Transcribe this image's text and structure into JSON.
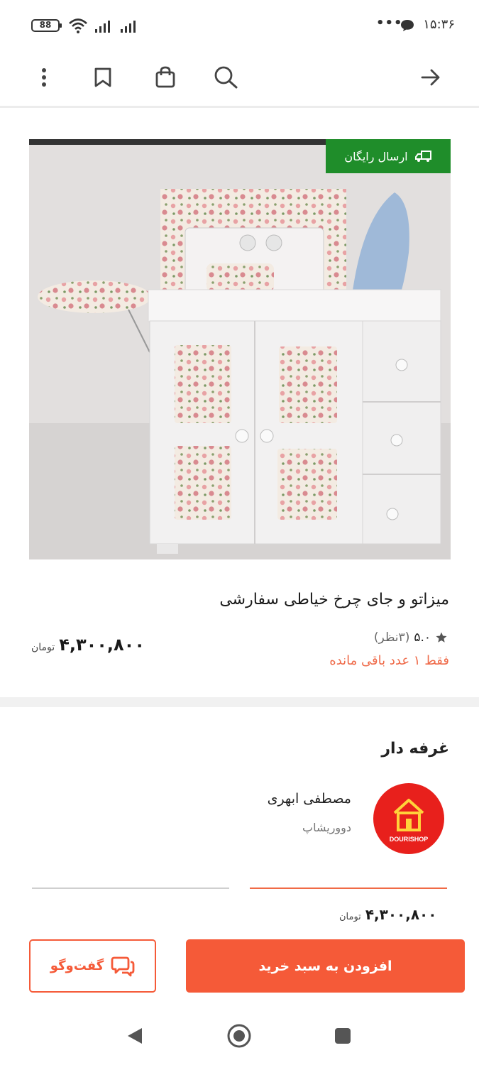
{
  "status_bar": {
    "battery": "88",
    "time": "۱۵:۳۶",
    "dots": "•••"
  },
  "product": {
    "free_shipping": "ارسال رایگان",
    "title": "میزاتو و جای چرخ خیاطی سفارشی",
    "rating": "۵.۰",
    "rating_count": "(۳نظر)",
    "stock": "فقط ۱ عدد باقی مانده",
    "price": "۴,۳۰۰,۸۰۰",
    "currency": "تومان"
  },
  "booth": {
    "title": "غرفه دار",
    "seller_name": "مصطفی ابهری",
    "shop_name": "دووریشاپ",
    "logo_text": "DOURISHOP"
  },
  "footer": {
    "price": "۴,۳۰۰,۸۰۰",
    "currency": "تومان",
    "add_to_cart": "افزودن به سبد خرید",
    "chat": "گفت‌وگو"
  },
  "colors": {
    "accent": "#f55a38",
    "free_shipping_bg": "#1f8d2a",
    "stock_text": "#ef6b4a"
  }
}
